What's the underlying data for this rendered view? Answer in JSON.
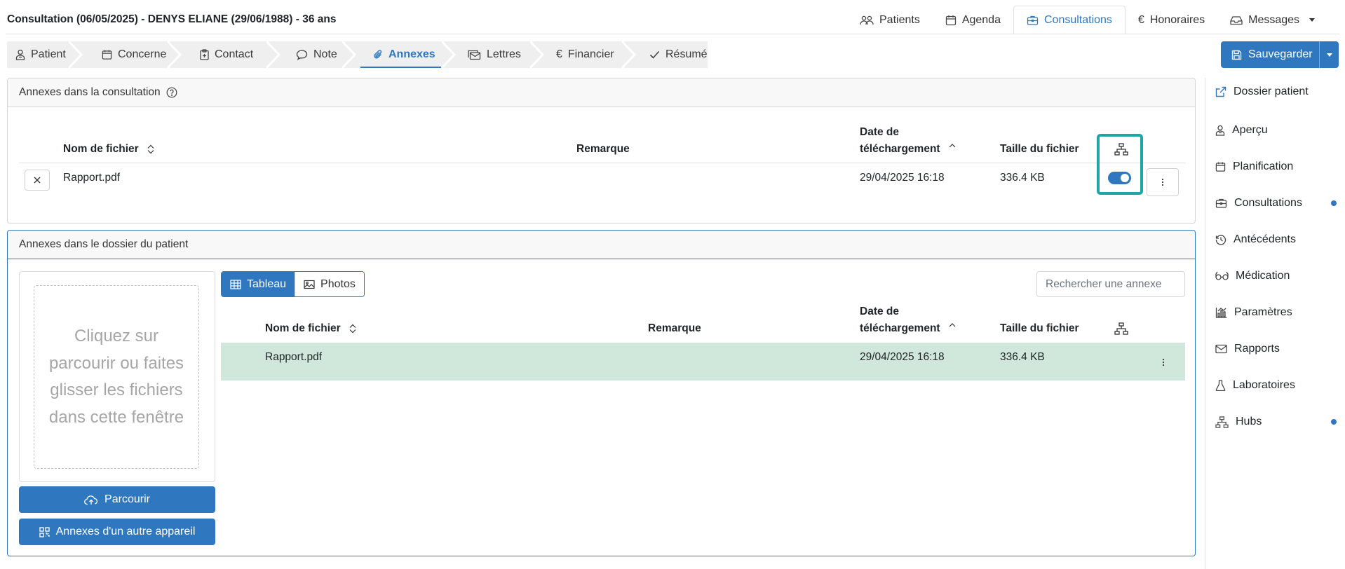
{
  "header": {
    "title": "Consultation (06/05/2025) - DENYS ELIANE (29/06/1988) - 36 ans",
    "nav": [
      {
        "label": "Patients",
        "icon": "users-icon"
      },
      {
        "label": "Agenda",
        "icon": "calendar-icon"
      },
      {
        "label": "Consultations",
        "icon": "briefcase-icon",
        "active": true
      },
      {
        "label": "Honoraires",
        "icon": "euro-icon"
      },
      {
        "label": "Messages",
        "icon": "inbox-icon",
        "dropdown": true
      }
    ]
  },
  "steps": [
    {
      "label": "Patient",
      "icon": "person-icon"
    },
    {
      "label": "Concerne",
      "icon": "calendar-icon"
    },
    {
      "label": "Contact",
      "icon": "clipboard-plus-icon"
    },
    {
      "label": "Note",
      "icon": "chat-icon"
    },
    {
      "label": "Annexes",
      "icon": "paperclip-icon",
      "active": true
    },
    {
      "label": "Lettres",
      "icon": "envelopes-icon"
    },
    {
      "label": "Financier",
      "icon": "euro-icon"
    },
    {
      "label": "Résumé",
      "icon": "check-icon"
    }
  ],
  "save_button": {
    "label": "Sauvegarder",
    "icon": "floppy-icon"
  },
  "consult_panel": {
    "title": "Annexes dans la consultation",
    "columns": {
      "filename": "Nom de fichier",
      "remark": "Remarque",
      "date_line1": "Date de",
      "date_line2": "téléchargement",
      "size": "Taille du fichier",
      "hub_icon": "hierarchy-icon"
    },
    "rows": [
      {
        "filename": "Rapport.pdf",
        "remark": "",
        "date": "29/04/2025 16:18",
        "size": "336.4 KB",
        "shared": true
      }
    ]
  },
  "patient_panel": {
    "title": "Annexes dans le dossier du patient",
    "drop_text": "Cliquez sur parcourir ou faites glisser les fichiers dans cette fenêtre",
    "browse_button": "Parcourir",
    "other_device_button": "Annexes d'un autre appareil",
    "view_tabs": [
      {
        "label": "Tableau",
        "icon": "table-icon",
        "active": true
      },
      {
        "label": "Photos",
        "icon": "image-icon"
      }
    ],
    "search_placeholder": "Rechercher une annexe",
    "columns": {
      "filename": "Nom de fichier",
      "remark": "Remarque",
      "date_line1": "Date de",
      "date_line2": "téléchargement",
      "size": "Taille du fichier",
      "hub_icon": "hierarchy-icon"
    },
    "rows": [
      {
        "filename": "Rapport.pdf",
        "remark": "",
        "date": "29/04/2025 16:18",
        "size": "336.4 KB"
      }
    ],
    "row_highlight_color": "#d0e8db"
  },
  "sidebar": {
    "items": [
      {
        "label": "Dossier patient",
        "icon": "external-link-icon"
      },
      {
        "label": "Aperçu",
        "icon": "person-icon"
      },
      {
        "label": "Planification",
        "icon": "calendar-icon"
      },
      {
        "label": "Consultations",
        "icon": "briefcase-icon",
        "badge": true
      },
      {
        "label": "Antécédents",
        "icon": "history-icon"
      },
      {
        "label": "Médication",
        "icon": "glasses-icon"
      },
      {
        "label": "Paramètres",
        "icon": "bar-chart-icon"
      },
      {
        "label": "Rapports",
        "icon": "envelope-icon"
      },
      {
        "label": "Laboratoires",
        "icon": "flask-icon"
      },
      {
        "label": "Hubs",
        "icon": "hierarchy-icon",
        "badge": true
      }
    ]
  },
  "colors": {
    "accent": "#2f78bf",
    "highlight_frame": "#1ea5a5",
    "badge": "#2f78bf"
  }
}
